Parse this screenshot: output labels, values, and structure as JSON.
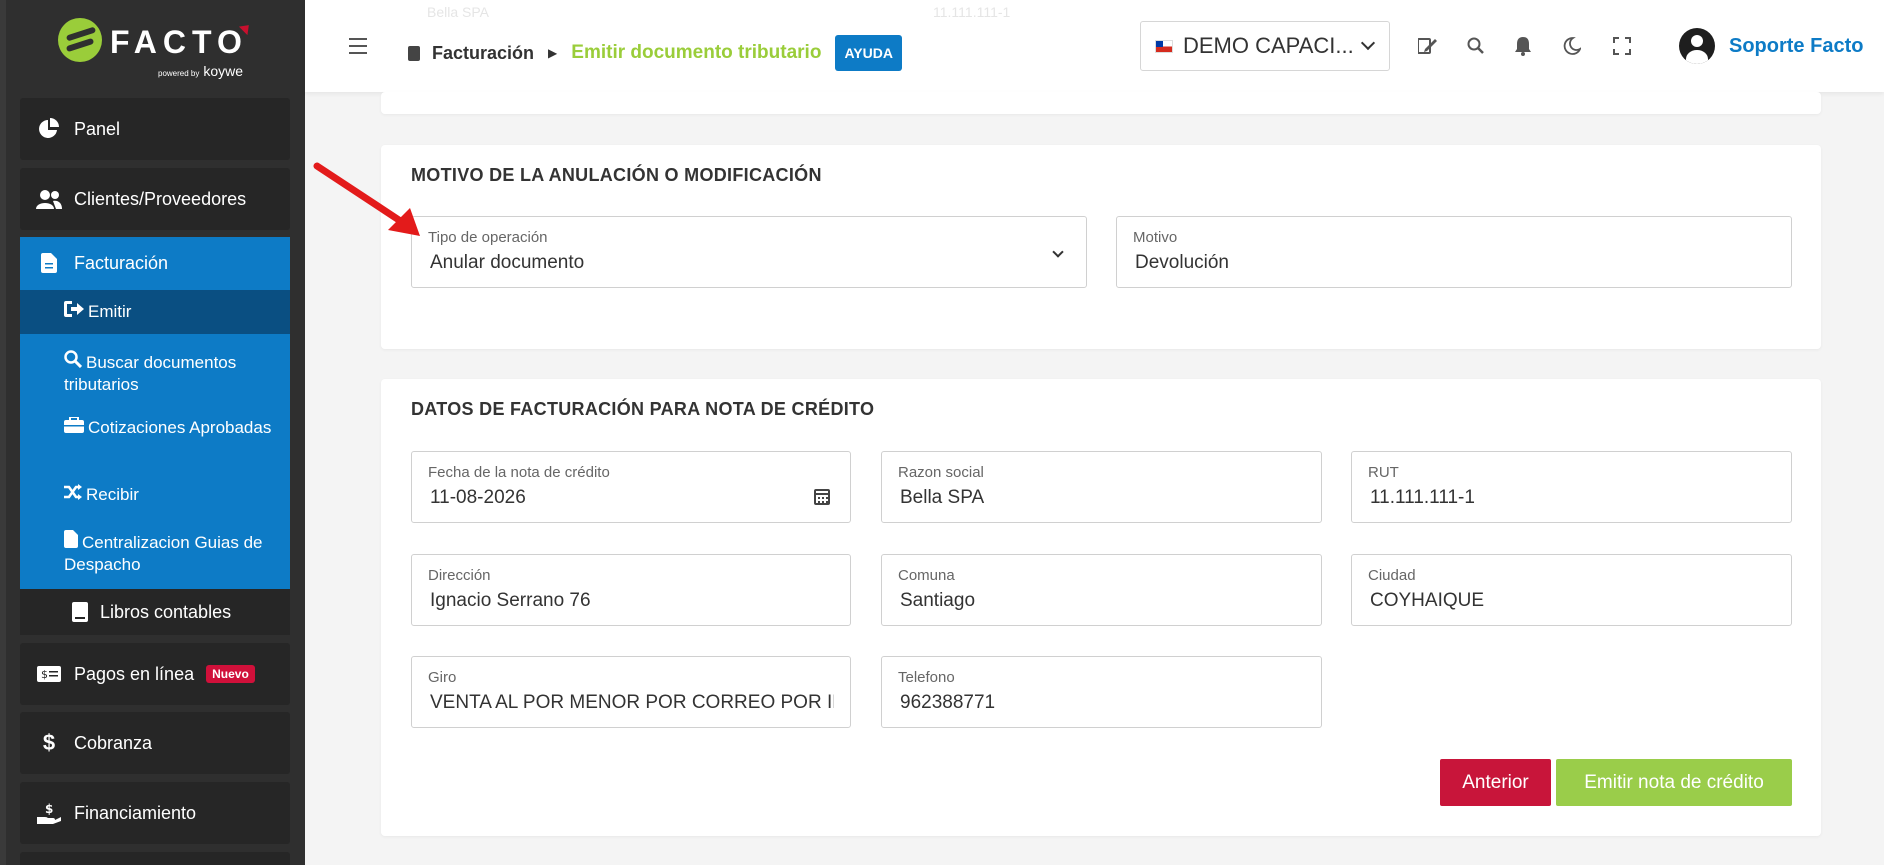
{
  "brand": {
    "logo_text": "FACTO",
    "powered": "powered by",
    "by_text": "koywe"
  },
  "sidebar": {
    "items": [
      {
        "label": "Panel",
        "icon": "pie-chart-icon"
      },
      {
        "label": "Clientes/Proveedores",
        "icon": "users-icon"
      },
      {
        "label": "Facturación",
        "icon": "file-icon"
      }
    ],
    "facturacion_sub": [
      {
        "label": "Emitir",
        "icon": "sign-out-icon",
        "active": true
      },
      {
        "label": "Buscar documentos tributarios",
        "icon": "search-icon"
      },
      {
        "label": "Cotizaciones Aprobadas",
        "icon": "briefcase-icon"
      },
      {
        "label": "Recibir",
        "icon": "shuffle-icon"
      },
      {
        "label": "Centralizacion Guias de Despacho",
        "icon": "file-icon"
      }
    ],
    "libros": {
      "label": "Libros contables",
      "icon": "book-icon"
    },
    "pagos": {
      "label": "Pagos en línea",
      "badge": "Nuevo",
      "icon": "money-bill-icon"
    },
    "cobranza": {
      "label": "Cobranza",
      "icon": "dollar-icon"
    },
    "financiamiento": {
      "label": "Financiamiento",
      "icon": "hand-dollar-icon"
    }
  },
  "header": {
    "crumb_parent": "Facturación",
    "crumb_current": "Emitir documento tributario",
    "help_label": "AYUDA",
    "company": "DEMO CAPACI...",
    "user_name": "Soporte Facto"
  },
  "motivo_section": {
    "title": "MOTIVO DE LA ANULACIÓN O MODIFICACIÓN",
    "tipo_label": "Tipo de operación",
    "tipo_value": "Anular documento",
    "motivo_label": "Motivo",
    "motivo_value": "Devolución"
  },
  "datos_section": {
    "title": "DATOS DE FACTURACIÓN PARA NOTA DE CRÉDITO",
    "fields": {
      "fecha": {
        "label": "Fecha de la nota de crédito",
        "value": "11-08-2026"
      },
      "razon": {
        "label": "Razon social",
        "value": "Bella SPA"
      },
      "rut": {
        "label": "RUT",
        "value": "11.111.111-1"
      },
      "direccion": {
        "label": "Dirección",
        "value": "Ignacio Serrano 76"
      },
      "comuna": {
        "label": "Comuna",
        "value": "Santiago"
      },
      "ciudad": {
        "label": "Ciudad",
        "value": "COYHAIQUE"
      },
      "giro": {
        "label": "Giro",
        "value": "VENTA AL POR MENOR POR CORREO POR INTERNET"
      },
      "telefono": {
        "label": "Telefono",
        "value": "962388771"
      }
    }
  },
  "buttons": {
    "prev": "Anterior",
    "emit": "Emitir nota de crédito"
  },
  "ghost_top": {
    "a": "Bella SPA",
    "b": "11.111.111-1"
  },
  "colors": {
    "primary": "#0d7bc6",
    "accent_green": "#9acd3a",
    "danger": "#c8153a",
    "sidebar_bg": "#2f2f2f"
  }
}
